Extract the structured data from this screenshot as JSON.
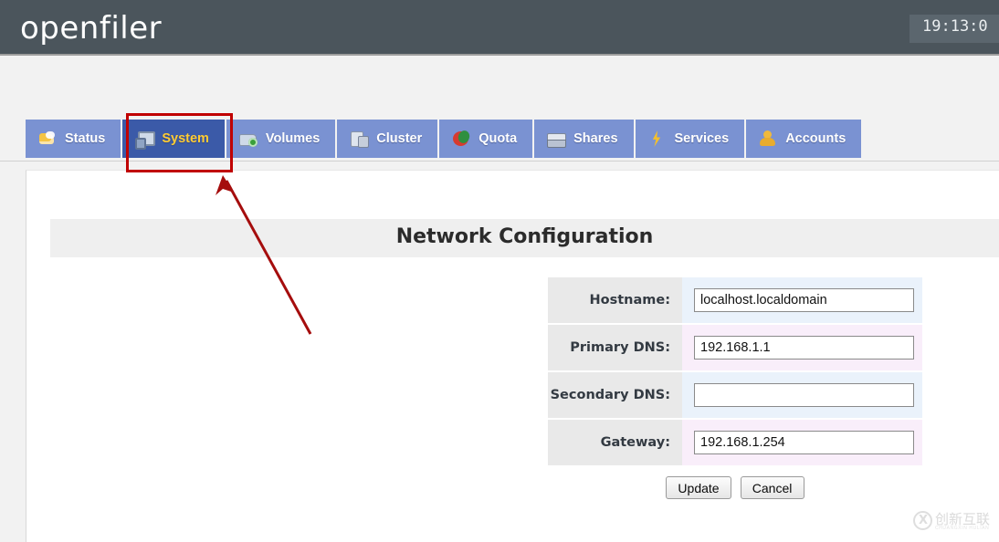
{
  "header": {
    "brand": "openfiler",
    "clock": "19:13:0"
  },
  "nav": {
    "tabs": [
      {
        "label": "Status",
        "icon": "status-icon",
        "active": false
      },
      {
        "label": "System",
        "icon": "system-icon",
        "active": true
      },
      {
        "label": "Volumes",
        "icon": "volumes-icon",
        "active": false
      },
      {
        "label": "Cluster",
        "icon": "cluster-icon",
        "active": false
      },
      {
        "label": "Quota",
        "icon": "quota-icon",
        "active": false
      },
      {
        "label": "Shares",
        "icon": "shares-icon",
        "active": false
      },
      {
        "label": "Services",
        "icon": "services-icon",
        "active": false
      },
      {
        "label": "Accounts",
        "icon": "accounts-icon",
        "active": false
      }
    ]
  },
  "main": {
    "page_title": "Network Configuration",
    "form": {
      "fields": [
        {
          "label": "Hostname:",
          "value": "localhost.localdomain",
          "placeholder": ""
        },
        {
          "label": "Primary DNS:",
          "value": "192.168.1.1",
          "placeholder": ""
        },
        {
          "label": "Secondary DNS:",
          "value": "",
          "placeholder": ""
        },
        {
          "label": "Gateway:",
          "value": "192.168.1.254",
          "placeholder": ""
        }
      ],
      "buttons": {
        "update": "Update",
        "cancel": "Cancel"
      }
    }
  },
  "annotations": {
    "highlight_target": "System",
    "color": "#c00000"
  },
  "watermark": {
    "text_cn": "创新互联",
    "text_en": "CHUANGXIN HULIAN"
  },
  "colors": {
    "header_bg": "#4b555c",
    "tab_bg": "#7a92d2",
    "tab_active_bg": "#3b5aa8",
    "tab_active_text": "#ffcc33",
    "page_bg": "#f2f2f2",
    "row_odd": "#eaf2fb",
    "row_even": "#f9eefa",
    "label_bg": "#e9e9e9"
  }
}
